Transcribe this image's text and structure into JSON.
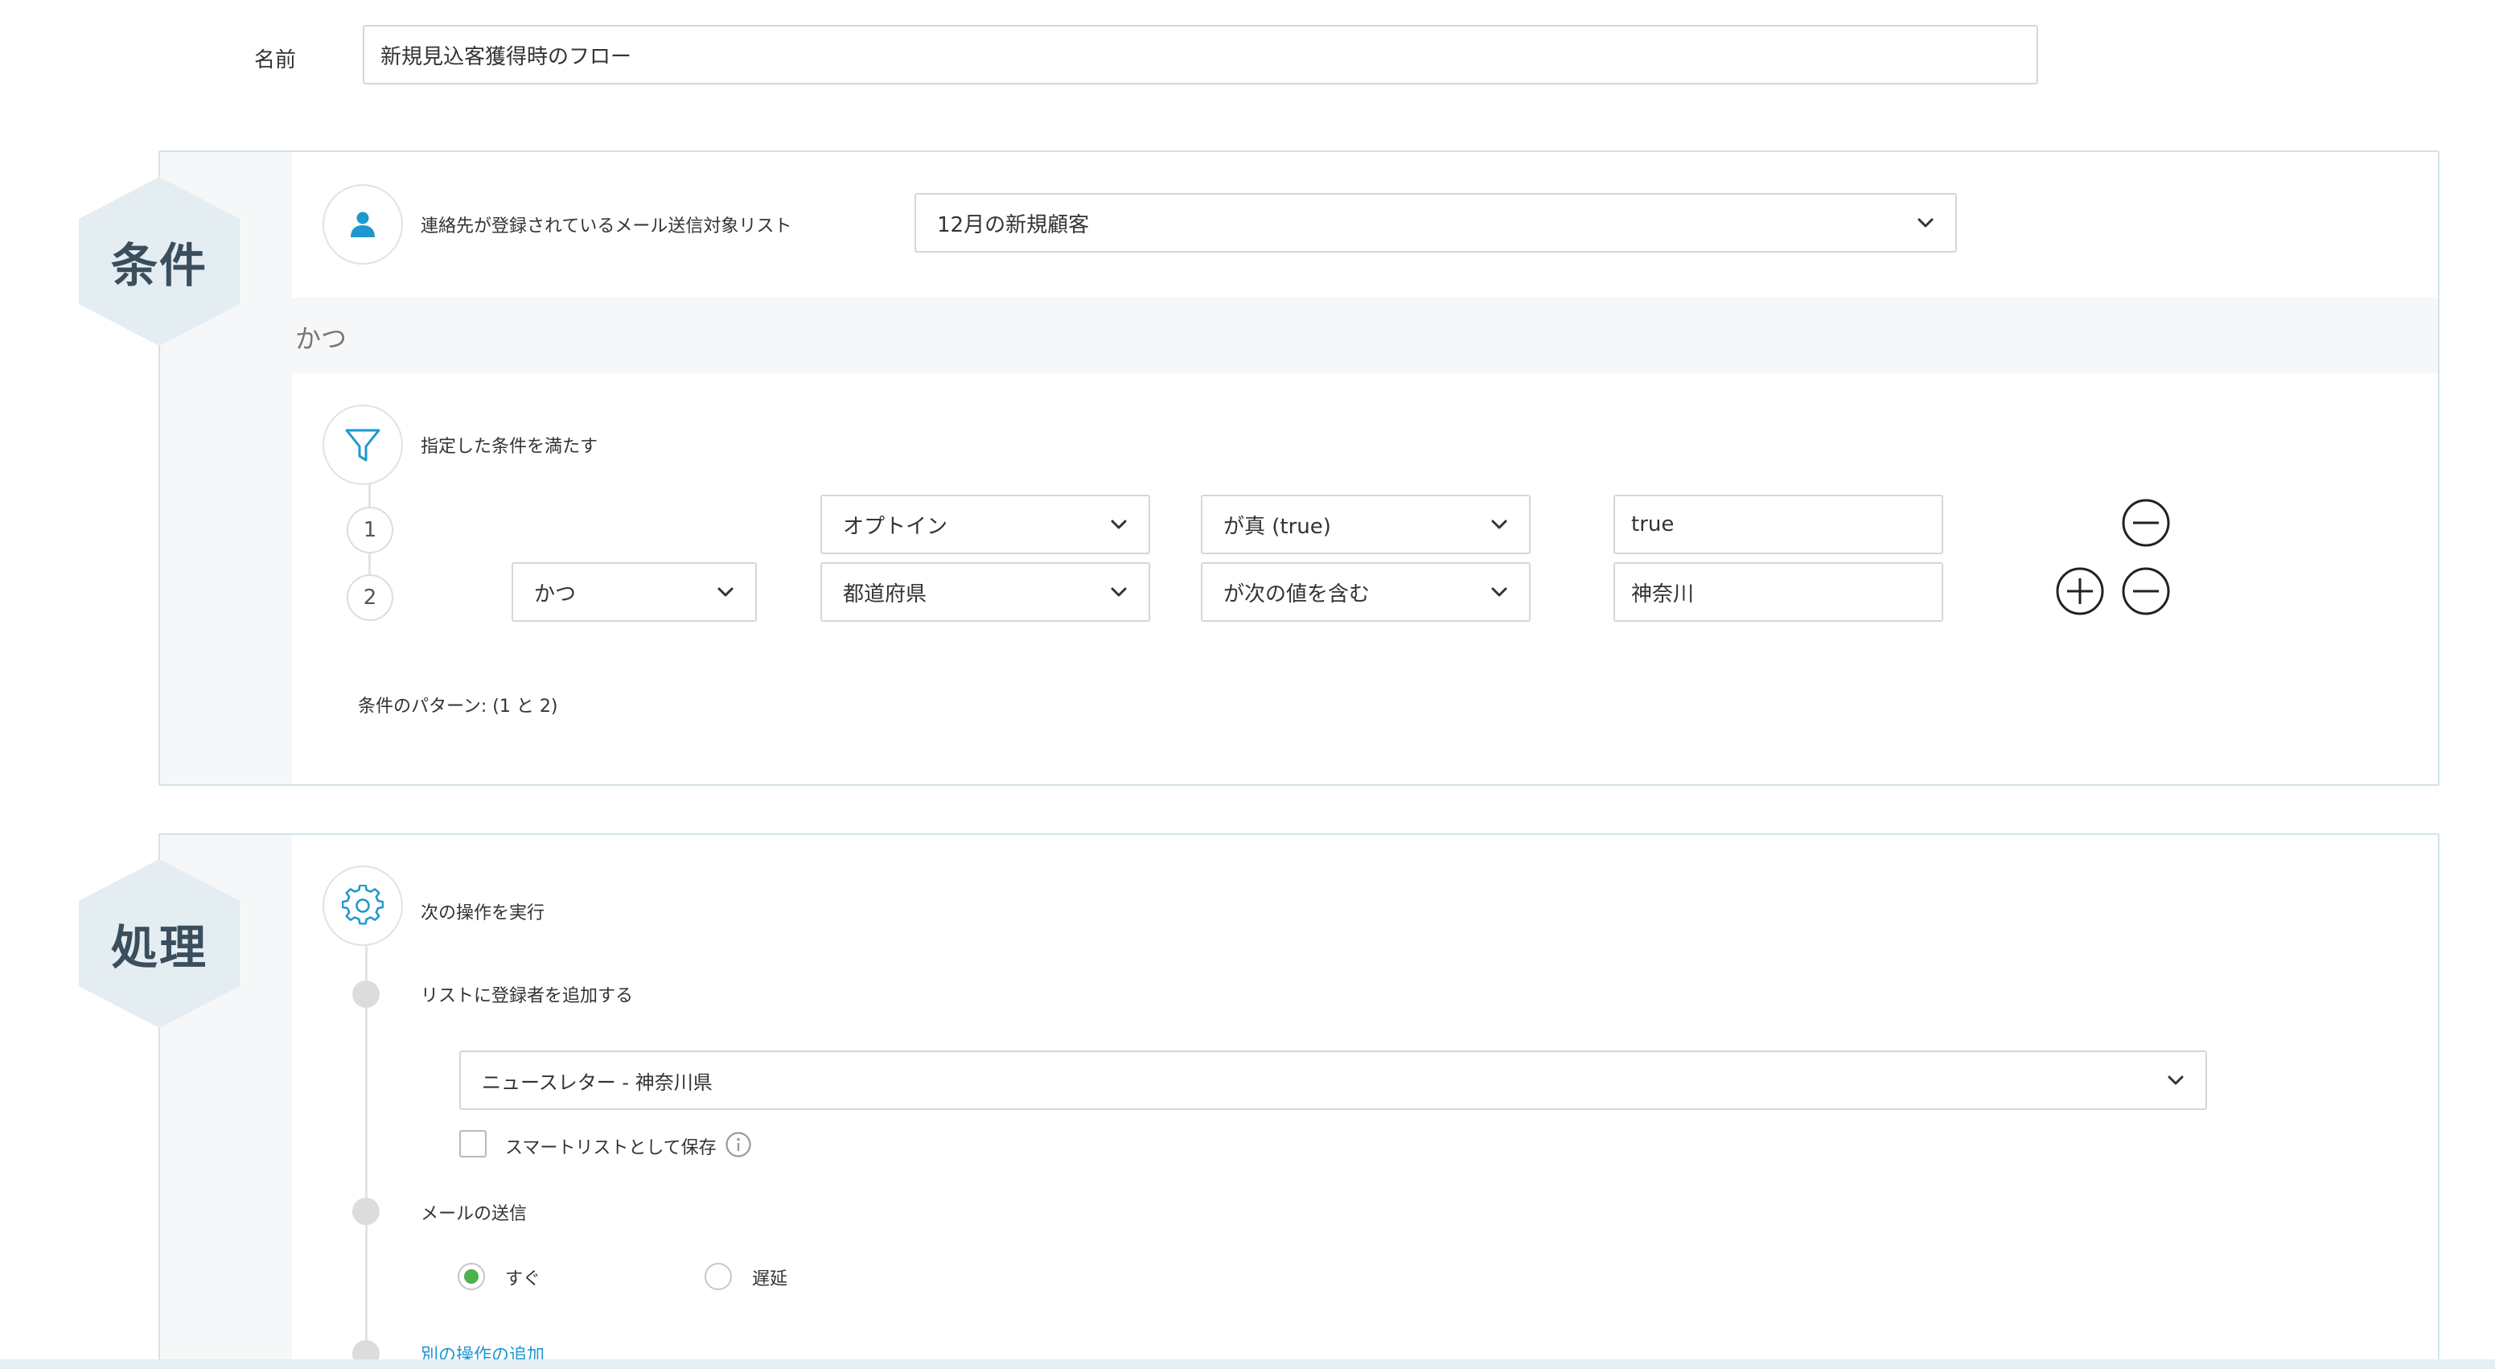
{
  "form": {
    "name_label": "名前",
    "name_value": "新規見込客獲得時のフロー"
  },
  "conditions": {
    "section_title": "条件",
    "list_label": "連絡先が登録されているメール送信対象リスト",
    "list_selected": "12月の新規顧客",
    "and_label": "かつ",
    "filter_label": "指定した条件を満たす",
    "rows": [
      {
        "number": "1",
        "field": "オプトイン",
        "operator": "が真 (true)",
        "value": "true"
      },
      {
        "number": "2",
        "connector": "かつ",
        "field": "都道府県",
        "operator": "が次の値を含む",
        "value": "神奈川"
      }
    ],
    "pattern_text": "条件のパターン:  (1 と 2)"
  },
  "actions": {
    "section_title": "処理",
    "run_label": "次の操作を実行",
    "add_to_list_label": "リストに登録者を追加する",
    "list_selected": "ニュースレター - 神奈川県",
    "smart_list_label": "スマートリストとして保存",
    "send_email_label": "メールの送信",
    "timing_options": [
      "すぐ",
      "遅延"
    ],
    "timing_selected": "すぐ",
    "add_action_link": "別の操作の追加"
  },
  "colors": {
    "accent": "#1e97d0",
    "hex_fill": "#e4edf2",
    "panel_border": "#d3e3ec",
    "radio_selected": "#4caf50"
  }
}
